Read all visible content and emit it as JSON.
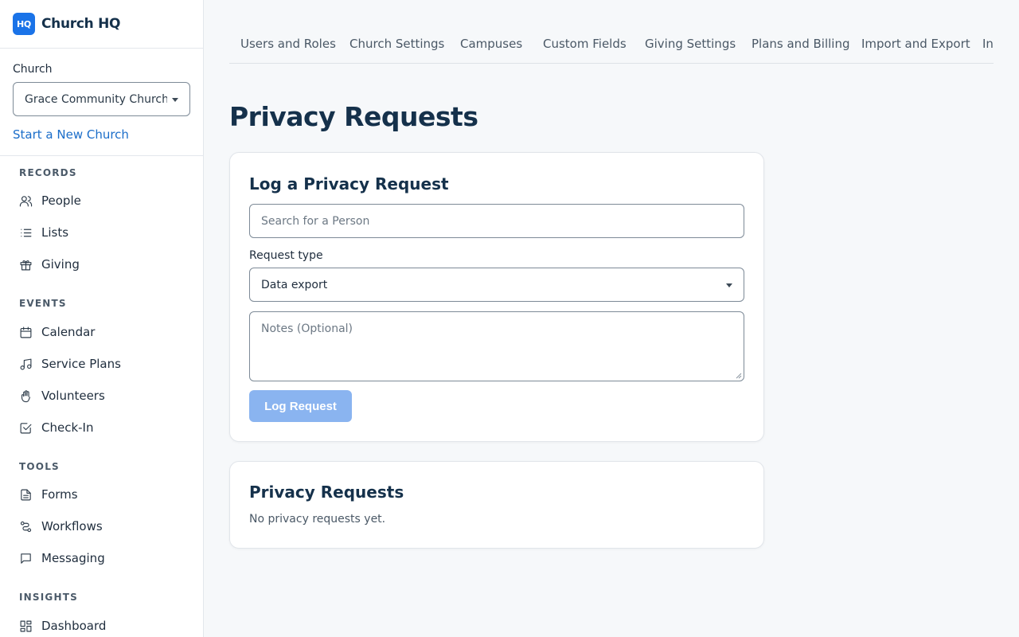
{
  "app": {
    "logo_text": "HQ",
    "name": "Church HQ",
    "accent": "#1a73e8"
  },
  "church": {
    "label": "Church",
    "selected": "Grace Community Church",
    "new_link": "Start a New Church"
  },
  "nav": {
    "records_label": "RECORDS",
    "people": "People",
    "lists": "Lists",
    "giving": "Giving",
    "events_label": "EVENTS",
    "calendar": "Calendar",
    "service_plans": "Service Plans",
    "volunteers": "Volunteers",
    "check_in": "Check-In",
    "tools_label": "TOOLS",
    "forms": "Forms",
    "workflows": "Workflows",
    "messaging": "Messaging",
    "insights_label": "INSIGHTS",
    "dashboard": "Dashboard"
  },
  "tabs": {
    "users_roles": "Users and Roles",
    "church_settings": "Church Settings",
    "campuses": "Campuses",
    "custom_fields": "Custom Fields",
    "giving_settings": "Giving Settings",
    "plans_billing": "Plans and Billing",
    "import_export": "Import and Export",
    "partial": "In"
  },
  "page": {
    "title": "Privacy Requests"
  },
  "log_card": {
    "title": "Log a Privacy Request",
    "search_placeholder": "Search for a Person",
    "request_type_label": "Request type",
    "request_type_value": "Data export",
    "notes_placeholder": "Notes (Optional)",
    "submit_label": "Log Request"
  },
  "list_card": {
    "title": "Privacy Requests",
    "empty_text": "No privacy requests yet."
  }
}
